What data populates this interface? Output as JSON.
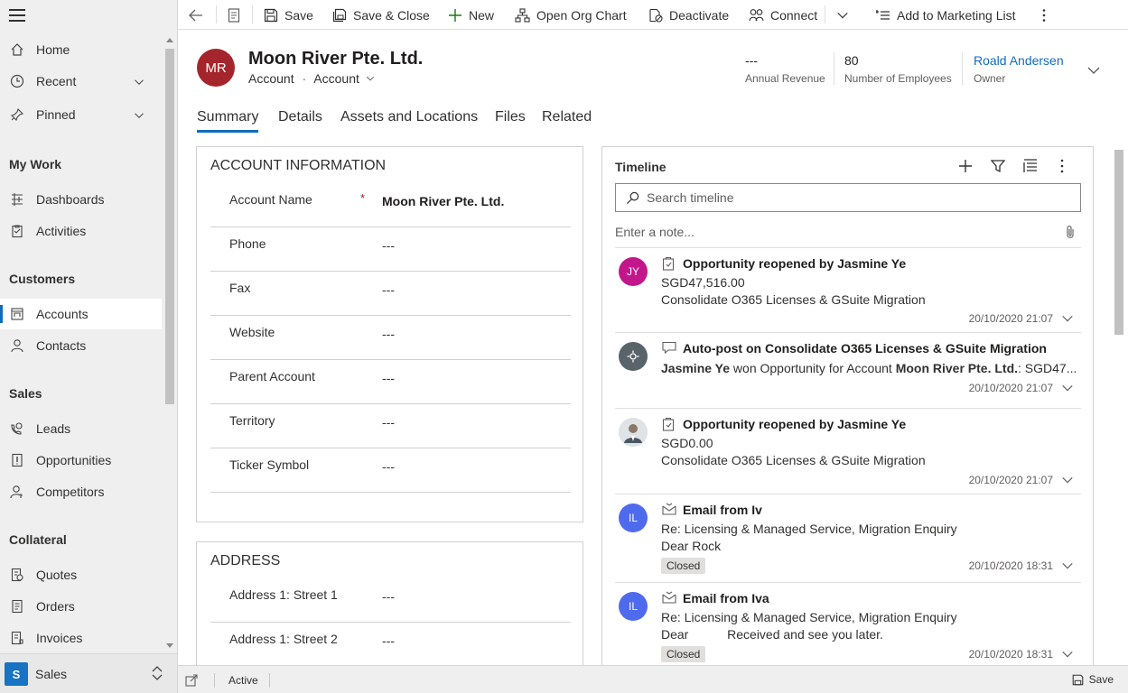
{
  "sidebar": {
    "items": {
      "home": "Home",
      "recent": "Recent",
      "pinned": "Pinned",
      "dashboards": "Dashboards",
      "activities": "Activities",
      "accounts": "Accounts",
      "contacts": "Contacts",
      "leads": "Leads",
      "opportunities": "Opportunities",
      "competitors": "Competitors",
      "quotes": "Quotes",
      "orders": "Orders",
      "invoices": "Invoices"
    },
    "sections": {
      "my_work": "My Work",
      "customers": "Customers",
      "sales": "Sales",
      "collateral": "Collateral"
    },
    "area": {
      "badge": "S",
      "label": "Sales"
    }
  },
  "toolbar": {
    "save": "Save",
    "save_close": "Save & Close",
    "new": "New",
    "org_chart": "Open Org Chart",
    "deactivate": "Deactivate",
    "connect": "Connect",
    "marketing": "Add to Marketing List"
  },
  "header": {
    "initials": "MR",
    "title": "Moon River Pte. Ltd.",
    "entity": "Account",
    "form": "Account",
    "revenue_value": "---",
    "revenue_label": "Annual Revenue",
    "employees_value": "80",
    "employees_label": "Number of Employees",
    "owner_value": "Roald Andersen",
    "owner_label": "Owner",
    "accent": "#0f6cbd"
  },
  "tabs": [
    "Summary",
    "Details",
    "Assets and Locations",
    "Files",
    "Related"
  ],
  "account_info": {
    "title": "ACCOUNT INFORMATION",
    "fields": [
      {
        "label": "Account Name",
        "value": "Moon River Pte. Ltd."
      },
      {
        "label": "Phone",
        "value": "---"
      },
      {
        "label": "Fax",
        "value": "---"
      },
      {
        "label": "Website",
        "value": "---"
      },
      {
        "label": "Parent Account",
        "value": "---"
      },
      {
        "label": "Territory",
        "value": "---"
      },
      {
        "label": "Ticker Symbol",
        "value": "---"
      }
    ]
  },
  "address": {
    "title": "ADDRESS",
    "fields": [
      {
        "label": "Address 1: Street 1",
        "value": "---"
      },
      {
        "label": "Address 1: Street 2",
        "value": "---"
      }
    ]
  },
  "timeline": {
    "title": "Timeline",
    "search_placeholder": "Search timeline",
    "note_placeholder": "Enter a note...",
    "items": [
      {
        "avatar": "JY",
        "heading": "Opportunity reopened by Jasmine Ye",
        "line1": "SGD47,516.00",
        "line2": "Consolidate O365 Licenses & GSuite Migration",
        "date": "20/10/2020 21:07"
      },
      {
        "heading": "Auto-post on Consolidate O365 Licenses & GSuite Migration",
        "line1_name": "Jasmine Ye",
        "line1_mid": " won Opportunity for Account ",
        "line1_account": "Moon River Pte. Ltd.",
        "line1_tail": ": SGD47...",
        "date": "20/10/2020 21:07"
      },
      {
        "heading": "Opportunity reopened by Jasmine Ye",
        "line1": "SGD0.00",
        "line2": "Consolidate O365 Licenses & GSuite Migration",
        "date": "20/10/2020 21:07"
      },
      {
        "avatar": "IL",
        "heading": "Email from Iv",
        "line1": "Re: Licensing & Managed Service, Migration Enquiry",
        "line2": "Dear Rock",
        "badge": "Closed",
        "date": "20/10/2020 18:31"
      },
      {
        "avatar": "IL",
        "heading": "Email from Iva",
        "line1": "Re: Licensing & Managed Service, Migration Enquiry",
        "line2": "Dear           Received and see you later.",
        "badge": "Closed",
        "date": "20/10/2020 18:31"
      }
    ]
  },
  "status": {
    "state": "Active",
    "save": "Save"
  }
}
